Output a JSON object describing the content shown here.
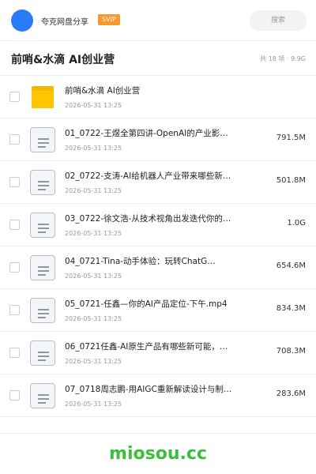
{
  "header": {
    "share_name": "夸克网盘分享",
    "badge": "SVIP",
    "search_placeholder": "搜索"
  },
  "folder": {
    "title": "前哨&水滴 AI创业营",
    "summary": "共 18 项 · 9.9G"
  },
  "items": [
    {
      "type": "folder",
      "name": "前哨&水滴 AI创业营",
      "date": "2026-05-31 13:25",
      "size": ""
    },
    {
      "type": "file",
      "name": "01_0722-王煜全第四讲-OpenAI的产业影…",
      "date": "2026-05-31 13:25",
      "size": "791.5M"
    },
    {
      "type": "file",
      "name": "02_0722-支涛-AI给机器人产业带来哪些新机…",
      "date": "2026-05-31 13:25",
      "size": "501.8M"
    },
    {
      "type": "file",
      "name": "03_0722-徐文浩-从技术视角出发迭代你的产品…",
      "date": "2026-05-31 13:25",
      "size": "1.0G"
    },
    {
      "type": "file",
      "name": "04_0721-Tina-动手体验：玩转ChatG…",
      "date": "2026-05-31 13:25",
      "size": "654.6M"
    },
    {
      "type": "file",
      "name": "05_0721-任鑫—你的AI产品定位-下午.mp4",
      "date": "2026-05-31 13:25",
      "size": "834.3M"
    },
    {
      "type": "file",
      "name": "06_0721任鑫-AI原生产品有哪些新可能，如何…",
      "date": "2026-05-31 13:25",
      "size": "708.3M"
    },
    {
      "type": "file",
      "name": "07_0718周志鹏-用AIGC重新解读设计与制造…",
      "date": "2026-05-31 13:25",
      "size": "283.6M"
    }
  ],
  "watermark": "miosou.cc"
}
